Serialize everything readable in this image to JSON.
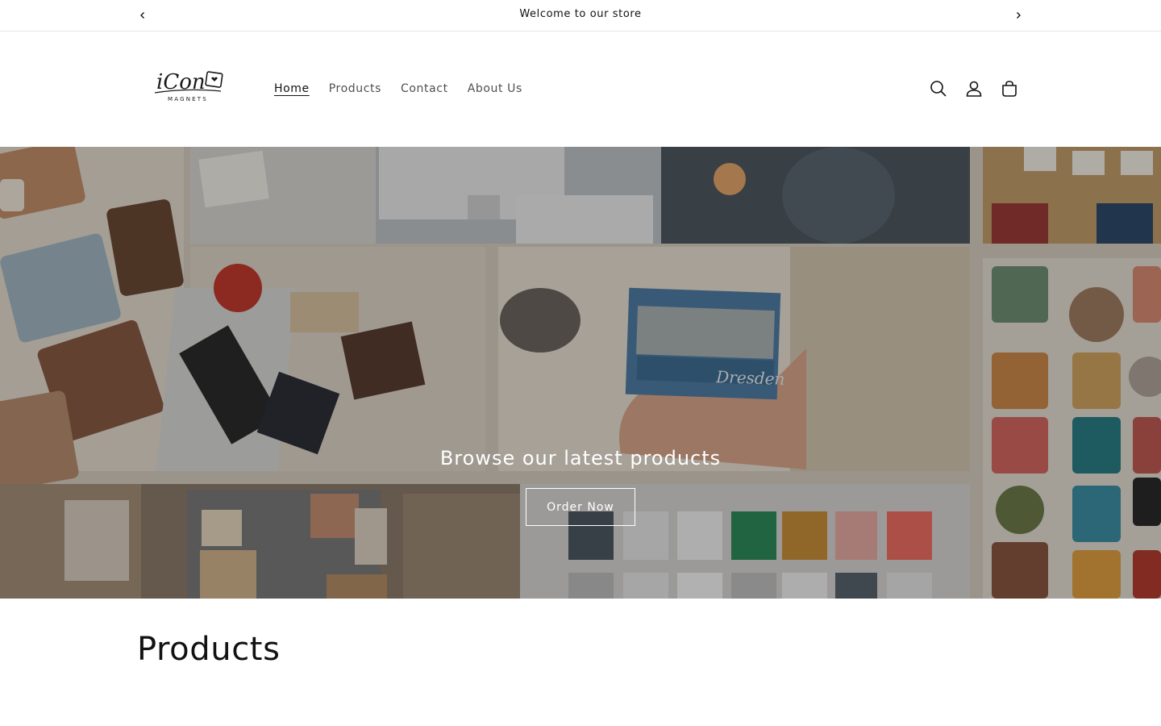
{
  "announcement": {
    "text": "Welcome to our store",
    "prev_icon": "chevron-left-icon",
    "next_icon": "chevron-right-icon"
  },
  "header": {
    "logo": {
      "brand": "iCon",
      "subtitle": "MAGNETS"
    },
    "nav": [
      {
        "label": "Home",
        "active": true
      },
      {
        "label": "Products",
        "active": false
      },
      {
        "label": "Contact",
        "active": false
      },
      {
        "label": "About Us",
        "active": false
      }
    ],
    "icons": [
      "search-icon",
      "account-icon",
      "cart-icon"
    ]
  },
  "hero": {
    "heading": "Browse our latest products",
    "button_label": "Order Now",
    "magnet_caption": "Dresden"
  },
  "products": {
    "title": "Products"
  }
}
